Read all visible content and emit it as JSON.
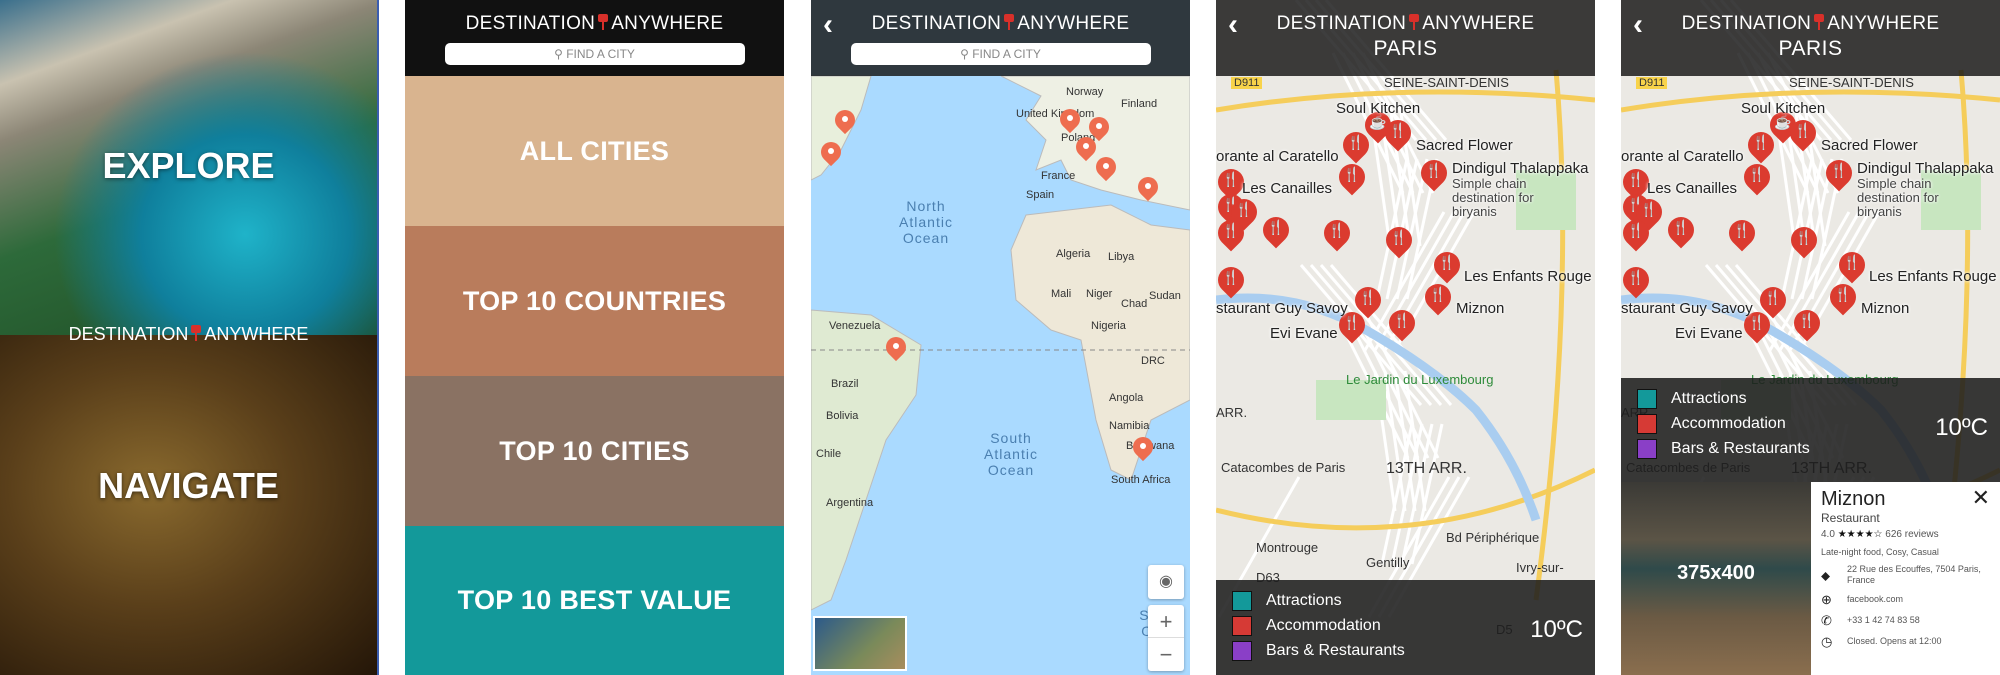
{
  "brand": {
    "left": "DESTINATION",
    "right": "ANYWHERE"
  },
  "search": {
    "placeholder": "FIND A CITY",
    "icon": "search-icon"
  },
  "splash": {
    "explore": "EXPLORE",
    "navigate": "NAVIGATE"
  },
  "menu": {
    "items": [
      {
        "label": "ALL CITIES",
        "color": "#d9b48f"
      },
      {
        "label": "TOP 10 COUNTRIES",
        "color": "#b97c5c"
      },
      {
        "label": "TOP 10 CITIES",
        "color": "#8a7263"
      },
      {
        "label": "TOP 10 BEST VALUE",
        "color": "#13999a"
      }
    ]
  },
  "world_map": {
    "oceans": [
      "North Atlantic Ocean",
      "South Atlantic Ocean",
      "South Ocea"
    ],
    "labels": [
      "Norway",
      "United Kingdom",
      "Poland",
      "France",
      "Spain",
      "Finland",
      "Algeria",
      "Libya",
      "Mali",
      "Niger",
      "Chad",
      "Nigeria",
      "Sudan",
      "DRC",
      "Angola",
      "Namibia",
      "Botswana",
      "South Africa",
      "Venezuela",
      "Brazil",
      "Bolivia",
      "Chile",
      "Argentina"
    ],
    "zoom_in": "+",
    "zoom_out": "−"
  },
  "city": {
    "name": "PARIS",
    "temperature": "10ºC",
    "places": [
      "Soul Kitchen",
      "Sacred Flower",
      "orante al Caratello",
      "Dindigul Thalappaka",
      "Les Canailles",
      "Les Enfants Rouge",
      "staurant Guy Savoy",
      "Miznon",
      "Evi Evane"
    ],
    "place_note": "Simple chain destination for biryanis",
    "map_labels": [
      "D911",
      "SEINE-SAINT-DENIS",
      "Le Jardin du Luxembourg",
      "Catacombes de Paris",
      "13TH ARR.",
      "ARR.",
      "Montrouge",
      "Gentilly",
      "Ivry-sur-",
      "Bd Périphérique",
      "D63",
      "D5"
    ],
    "legend": [
      {
        "label": "Attractions",
        "color": "#13999a"
      },
      {
        "label": "Accommodation",
        "color": "#d63a35"
      },
      {
        "label": "Bars & Restaurants",
        "color": "#8a3fc7"
      }
    ]
  },
  "detail": {
    "image_label": "375x400",
    "name": "Miznon",
    "type": "Restaurant",
    "rating": "4.0",
    "stars": 4,
    "stars_text": "★★★★☆",
    "reviews": "626 reviews",
    "tags": "Late-night food, Cosy, Casual",
    "address": "22 Rue des Ecouffes, 7504 Paris, France",
    "website": "facebook.com",
    "phone": "+33 1 42 74 83 58",
    "hours": "Closed. Opens at 12:00"
  },
  "colors": {
    "pin_world": "#ee6d4f",
    "pin_restaurant": "#db3b2f",
    "header": "#111111"
  }
}
